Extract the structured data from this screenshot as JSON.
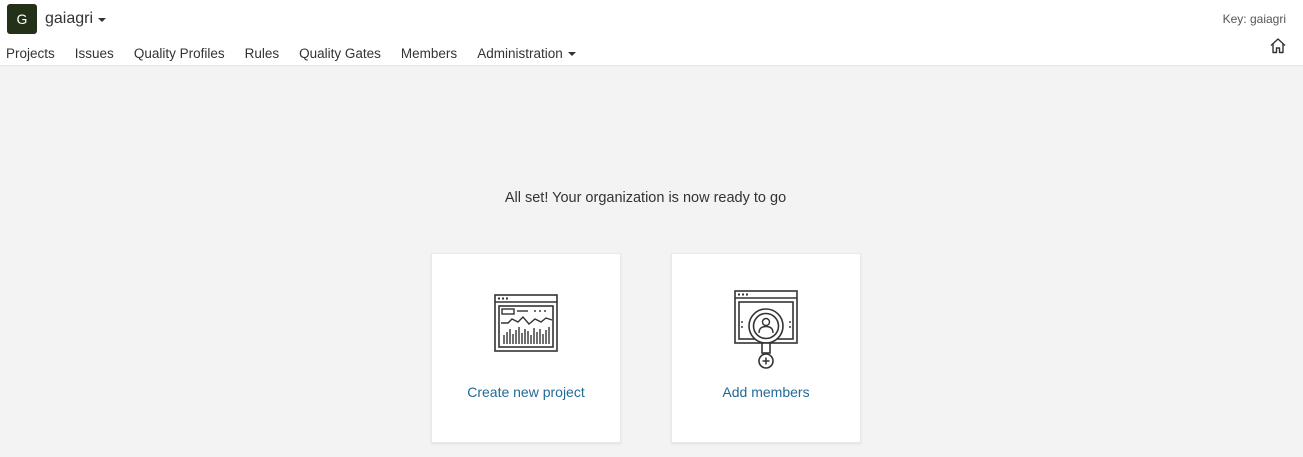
{
  "org": {
    "avatar_letter": "G",
    "name": "gaiagri",
    "key_label": "Key: gaiagri"
  },
  "nav": {
    "items": [
      {
        "label": "Projects"
      },
      {
        "label": "Issues"
      },
      {
        "label": "Quality Profiles"
      },
      {
        "label": "Rules"
      },
      {
        "label": "Quality Gates"
      },
      {
        "label": "Members"
      },
      {
        "label": "Administration"
      }
    ]
  },
  "main": {
    "ready_message": "All set! Your organization is now ready to go",
    "cards": [
      {
        "label": "Create new project",
        "icon": "project-dashboard-icon"
      },
      {
        "label": "Add members",
        "icon": "add-member-icon"
      }
    ]
  },
  "colors": {
    "avatar_bg": "#233119",
    "link": "#236a97",
    "background": "#f3f3f3"
  }
}
